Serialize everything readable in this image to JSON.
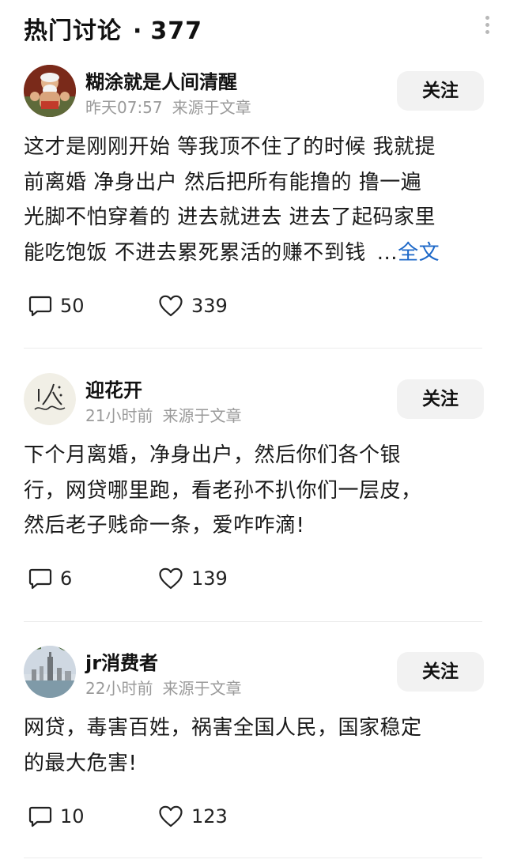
{
  "header": {
    "title": "热门讨论",
    "separator": "·",
    "count": "377",
    "more_icon": "more-vertical-icon"
  },
  "comments": [
    {
      "user": "糊涂就是人间清醒",
      "time": "昨天07:57",
      "source": "来源于文章",
      "follow_label": "关注",
      "lines": [
        "这才是刚刚开始 等我顶不住了的时候 我就提",
        "前离婚 净身出户 然后把所有能撸的 撸一遍",
        "光脚不怕穿着的 进去就进去 进去了起码家里",
        "能吃饱饭 不进去累死累活的赚不到钱"
      ],
      "ellipsis": "...",
      "expand_label": "全文",
      "reply_count": "50",
      "like_count": "339"
    },
    {
      "user": "迎花开",
      "time": "21小时前",
      "source": "来源于文章",
      "follow_label": "关注",
      "lines": [
        "下个月离婚，净身出户，然后你们各个银",
        "行，网贷哪里跑，看老孙不扒你们一层皮，",
        "然后老子贱命一条，爱咋咋滴!"
      ],
      "reply_count": "6",
      "like_count": "139"
    },
    {
      "user": "jr消费者",
      "time": "22小时前",
      "source": "来源于文章",
      "follow_label": "关注",
      "lines": [
        "网贷，毒害百姓，祸害全国人民，国家稳定",
        "的最大危害!"
      ],
      "reply_count": "10",
      "like_count": "123"
    }
  ],
  "colors": {
    "link": "#1d68c8",
    "meta": "#9a9a9a",
    "button_bg": "#f2f2f2"
  }
}
